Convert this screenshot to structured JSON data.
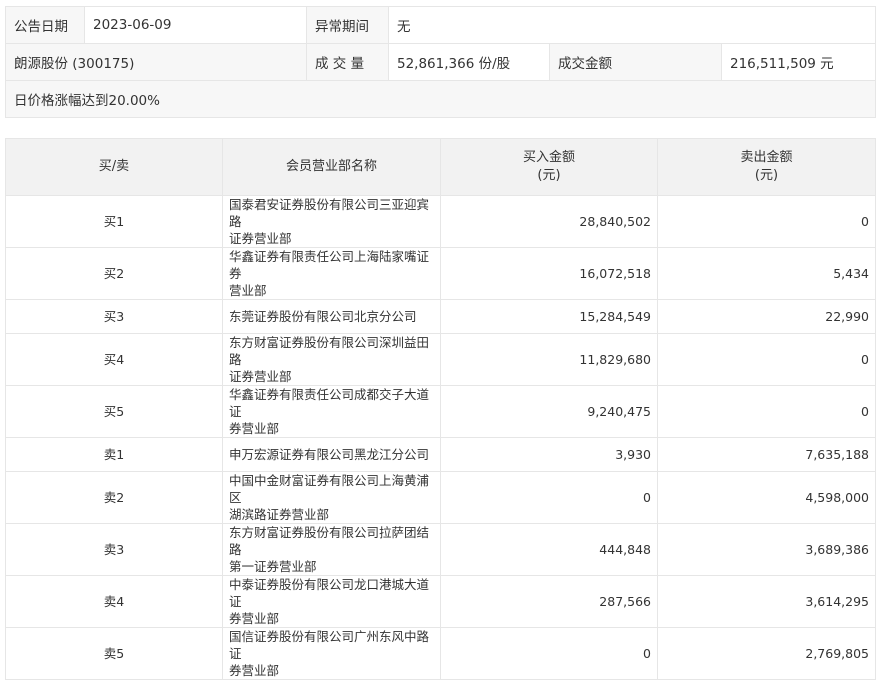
{
  "info": {
    "announce_date_label": "公告日期",
    "announce_date": "2023-06-09",
    "abnormal_period_label": "异常期间",
    "abnormal_period": "无",
    "stock_name": "朗源股份 (300175)",
    "volume_label": "成 交 量",
    "volume": "52,861,366 份/股",
    "turnover_label": "成交金额",
    "turnover": "216,511,509 元",
    "reason": "日价格涨幅达到20.00%"
  },
  "table": {
    "headers": {
      "direction": "买/卖",
      "branch": "会员营业部名称",
      "buy_line1": "买入金额",
      "buy_line2": "(元)",
      "sell_line1": "卖出金额",
      "sell_line2": "(元)"
    },
    "rows": [
      {
        "direction": "买1",
        "branch_line1": "国泰君安证券股份有限公司三亚迎宾路",
        "branch_line2": "证券营业部",
        "buy": "28,840,502",
        "sell": "0"
      },
      {
        "direction": "买2",
        "branch_line1": "华鑫证券有限责任公司上海陆家嘴证券",
        "branch_line2": "营业部",
        "buy": "16,072,518",
        "sell": "5,434"
      },
      {
        "direction": "买3",
        "branch_line1": "东莞证券股份有限公司北京分公司",
        "branch_line2": "",
        "buy": "15,284,549",
        "sell": "22,990"
      },
      {
        "direction": "买4",
        "branch_line1": "东方财富证券股份有限公司深圳益田路",
        "branch_line2": "证券营业部",
        "buy": "11,829,680",
        "sell": "0"
      },
      {
        "direction": "买5",
        "branch_line1": "华鑫证券有限责任公司成都交子大道证",
        "branch_line2": "券营业部",
        "buy": "9,240,475",
        "sell": "0"
      },
      {
        "direction": "卖1",
        "branch_line1": "申万宏源证券有限公司黑龙江分公司",
        "branch_line2": "",
        "buy": "3,930",
        "sell": "7,635,188"
      },
      {
        "direction": "卖2",
        "branch_line1": "中国中金财富证券有限公司上海黄浦区",
        "branch_line2": "湖滨路证券营业部",
        "buy": "0",
        "sell": "4,598,000"
      },
      {
        "direction": "卖3",
        "branch_line1": "东方财富证券股份有限公司拉萨团结路",
        "branch_line2": "第一证券营业部",
        "buy": "444,848",
        "sell": "3,689,386"
      },
      {
        "direction": "卖4",
        "branch_line1": "中泰证券股份有限公司龙口港城大道证",
        "branch_line2": "券营业部",
        "buy": "287,566",
        "sell": "3,614,295"
      },
      {
        "direction": "卖5",
        "branch_line1": "国信证券股份有限公司广州东风中路证",
        "branch_line2": "券营业部",
        "buy": "0",
        "sell": "2,769,805"
      }
    ]
  }
}
